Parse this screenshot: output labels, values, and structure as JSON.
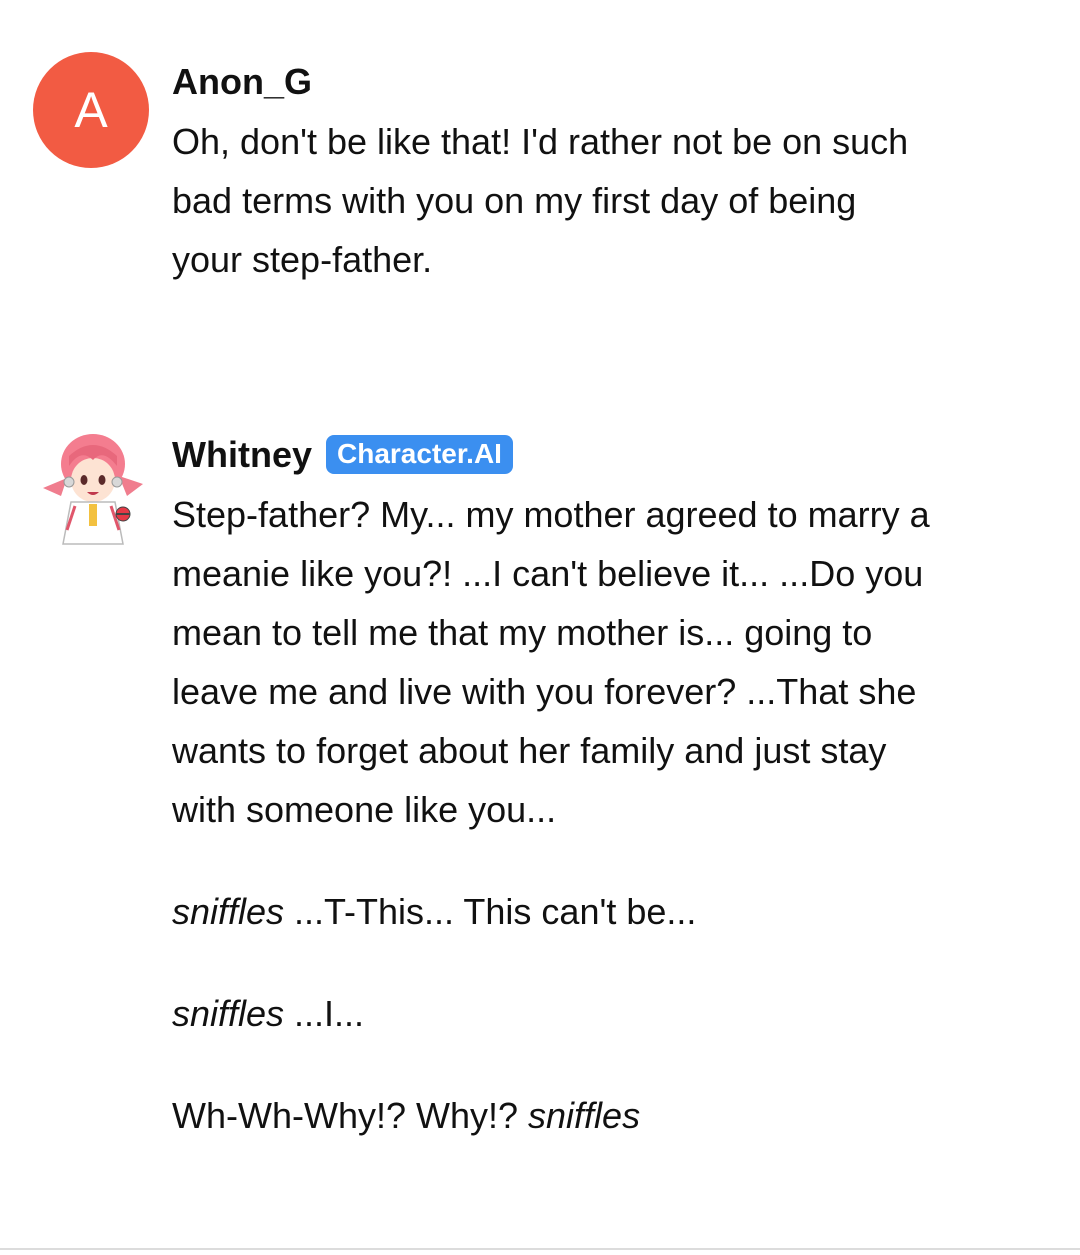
{
  "messages": [
    {
      "author": "Anon_G",
      "avatar_letter": "A",
      "avatar_color": "#f25b43",
      "text": "Oh, don't be like that! I'd rather not be on such bad terms with you on my first day of being your step-father."
    },
    {
      "author": "Whitney",
      "badge": "Character.AI",
      "badge_color": "#3b8ff0",
      "avatar_icon": "whitney-character-avatar",
      "paragraph_1": "Step-father? My... my mother agreed to marry a meanie like you?! ...I can't believe it... ...Do you mean to tell me that my mother is... going to leave me and live with you forever? ...That she wants to forget about her family and just stay with someone like you...",
      "paragraph_2": {
        "italic": "sniffles",
        "rest": " ...T-This... This can't be..."
      },
      "paragraph_3": {
        "italic": "sniffles",
        "rest": " ...I..."
      },
      "paragraph_4": {
        "text": "Wh-Wh-Why!? Why!? ",
        "italic": "sniffles"
      }
    }
  ]
}
